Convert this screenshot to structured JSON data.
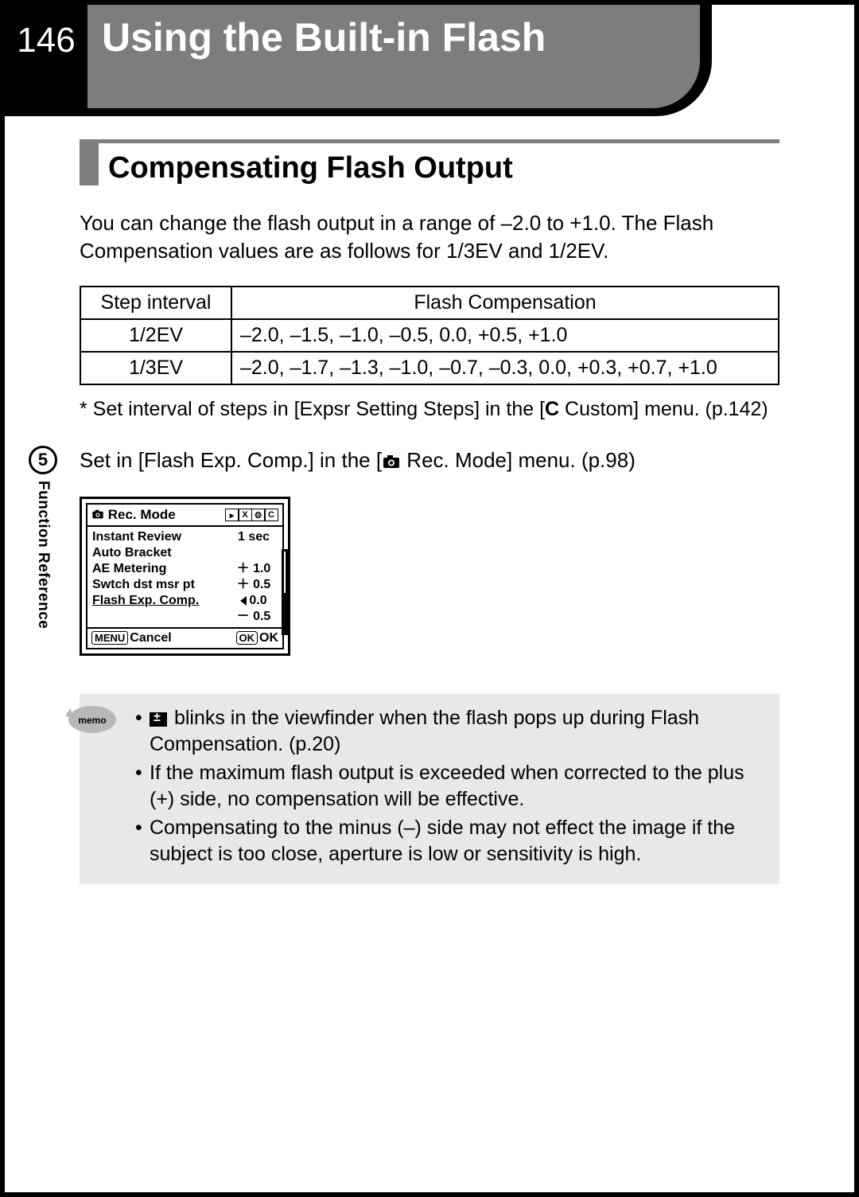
{
  "page_number": "146",
  "page_title": "Using the Built-in Flash",
  "section_title": "Compensating Flash Output",
  "intro": "You can change the flash output in a range of –2.0 to +1.0. The Flash Compensation values are as follows for 1/3EV and 1/2EV.",
  "table": {
    "headers": [
      "Step interval",
      "Flash Compensation"
    ],
    "rows": [
      {
        "step": "1/2EV",
        "vals": "–2.0, –1.5, –1.0, –0.5, 0.0, +0.5, +1.0"
      },
      {
        "step": "1/3EV",
        "vals": "–2.0, –1.7, –1.3, –1.0, –0.7, –0.3, 0.0, +0.3, +0.7, +1.0"
      }
    ]
  },
  "footnote_pre": "* Set interval of steps in [Expsr Setting Steps] in the [",
  "footnote_c": "C",
  "footnote_post": " Custom] menu. (p.142)",
  "setline_pre": "Set in [Flash Exp. Comp.] in the [",
  "setline_post": " Rec. Mode] menu. (p.98)",
  "side": {
    "num": "5",
    "label": "Function Reference"
  },
  "lcd": {
    "head_title": "Rec. Mode",
    "head_icons": [
      "▸",
      "X",
      "⚙",
      "C"
    ],
    "rows": [
      {
        "lab": "Instant Review",
        "val": "1 sec"
      },
      {
        "lab": "Auto Bracket",
        "val": ""
      },
      {
        "lab": "AE Metering",
        "val": "＋ 1.0"
      },
      {
        "lab": "Swtch dst msr pt",
        "val": "＋ 0.5"
      },
      {
        "lab": "Flash Exp. Comp.",
        "val": "0.0",
        "hl": true,
        "arrow": true
      },
      {
        "lab": "",
        "val": "－ 0.5"
      }
    ],
    "foot_left_btn": "MENU",
    "foot_left": "Cancel",
    "foot_right_btn": "OK",
    "foot_right": "OK"
  },
  "memo": {
    "label": "memo",
    "items": [
      {
        "icon": true,
        "text": " blinks in the viewfinder when the flash pops up during Flash Compensation. (p.20)"
      },
      {
        "icon": false,
        "text": "If the maximum flash output is exceeded when corrected to the plus (+) side, no compensation will be effective."
      },
      {
        "icon": false,
        "text": "Compensating to the minus (–) side may not effect the image if the subject is too close, aperture is low or sensitivity is high."
      }
    ]
  }
}
